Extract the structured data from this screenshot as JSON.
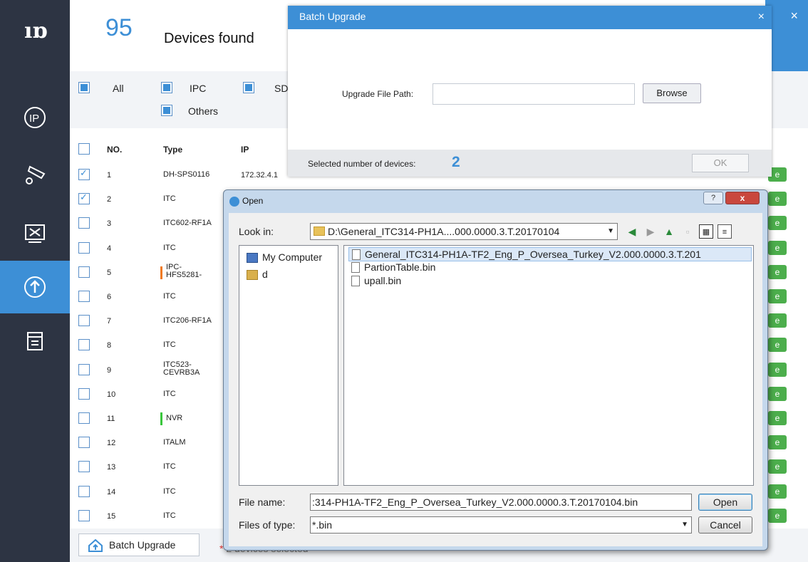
{
  "app": {
    "logo": "ıɒ",
    "count": "95",
    "found_label": "Devices found",
    "close": "×"
  },
  "sidebar": {
    "items": [
      {
        "name": "ip-icon",
        "label": "IP"
      },
      {
        "name": "camera-settings-icon"
      },
      {
        "name": "tools-icon"
      },
      {
        "name": "upgrade-icon",
        "active": true
      },
      {
        "name": "documents-icon"
      }
    ]
  },
  "filters": {
    "all": "All",
    "ipc": "IPC",
    "sd": "SD",
    "others": "Others"
  },
  "table": {
    "headers": {
      "no": "NO.",
      "type": "Type",
      "ip": "IP"
    },
    "rows": [
      {
        "no": "1",
        "type": "DH-SPS0116",
        "ip": "172.32.4.1",
        "checked": true
      },
      {
        "no": "2",
        "type": "ITC",
        "checked": true
      },
      {
        "no": "3",
        "type": "ITC602-RF1A"
      },
      {
        "no": "4",
        "type": "ITC"
      },
      {
        "no": "5",
        "type": "IPC-\nHFS5281-",
        "mark": "#f07a22"
      },
      {
        "no": "6",
        "type": "ITC"
      },
      {
        "no": "7",
        "type": "ITC206-RF1A"
      },
      {
        "no": "8",
        "type": "ITC"
      },
      {
        "no": "9",
        "type": "ITC523-\nCEVRB3A"
      },
      {
        "no": "10",
        "type": "ITC"
      },
      {
        "no": "11",
        "type": "NVR",
        "mark": "#39c63c"
      },
      {
        "no": "12",
        "type": "ITALM"
      },
      {
        "no": "13",
        "type": "ITC"
      },
      {
        "no": "14",
        "type": "ITC"
      },
      {
        "no": "15",
        "type": "ITC"
      }
    ],
    "row_action_label": "e"
  },
  "footer": {
    "batch_upgrade": "Batch Upgrade",
    "selected_msg": "2    devices selected",
    "star": "*"
  },
  "batch_dialog": {
    "title": "Batch Upgrade",
    "close": "×",
    "path_label": "Upgrade File Path:",
    "path_value": "",
    "browse": "Browse",
    "selected_label": "Selected number of devices:",
    "selected_count": "2",
    "ok": "OK"
  },
  "open_dialog": {
    "title": "Open",
    "help": "?",
    "close": "x",
    "look_in_label": "Look in:",
    "look_in_value": "D:\\General_ITC314-PH1A....000.0000.3.T.20170104",
    "places": [
      "My Computer",
      "d"
    ],
    "files": [
      "General_ITC314-PH1A-TF2_Eng_P_Oversea_Turkey_V2.000.0000.3.T.201",
      "PartionTable.bin",
      "upall.bin"
    ],
    "file_name_label": "File name:",
    "file_name_value": ":314-PH1A-TF2_Eng_P_Oversea_Turkey_V2.000.0000.3.T.20170104.bin",
    "open_button": "Open",
    "files_of_type_label": "Files of type:",
    "files_of_type_value": "*.bin",
    "cancel_button": "Cancel"
  },
  "colors": {
    "accent": "#3d8fd6",
    "sidebar": "#2d3443",
    "green": "#4cae4c"
  }
}
